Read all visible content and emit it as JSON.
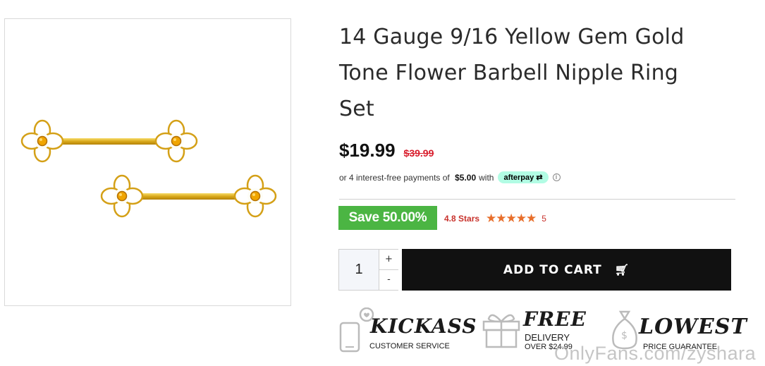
{
  "product": {
    "title_lines": [
      "14 Gauge 9/16 Yellow Gem Gold",
      "Tone Flower Barbell Nipple Ring",
      "Set"
    ],
    "price": "$19.99",
    "old_price": "$39.99",
    "afterpay": {
      "prefix": "or 4 interest-free payments of",
      "amount": "$5.00",
      "suffix": "with",
      "badge": "afterpay",
      "info_icon": "info-circle-icon"
    },
    "save_label": "Save 50.00%",
    "rating_text": "4.8 Stars",
    "stars": "★★★★★",
    "rating_value": 4.8,
    "review_count": "5"
  },
  "cart": {
    "quantity": "1",
    "plus_label": "+",
    "minus_label": "-",
    "button_label": "ADD TO CART",
    "cart_icon": "shopping-cart-icon"
  },
  "trust_badges": [
    {
      "script": "KICKASS",
      "caption": "CUSTOMER SERVICE",
      "icon": "phone-heart-icon"
    },
    {
      "script": "FREE",
      "caption1": "DELIVERY",
      "caption2": "OVER $24.99",
      "icon": "gift-box-icon"
    },
    {
      "script": "LOWEST",
      "caption": "PRICE GUARANTEE",
      "icon": "money-bag-icon"
    }
  ],
  "watermark": "OnlyFans.com/zyshara",
  "colors": {
    "save_green": "#4bb543",
    "old_price_red": "#d81c2b",
    "star_orange": "#e86e2a",
    "afterpay_mint": "#b2fce4",
    "button_black": "#111111"
  }
}
